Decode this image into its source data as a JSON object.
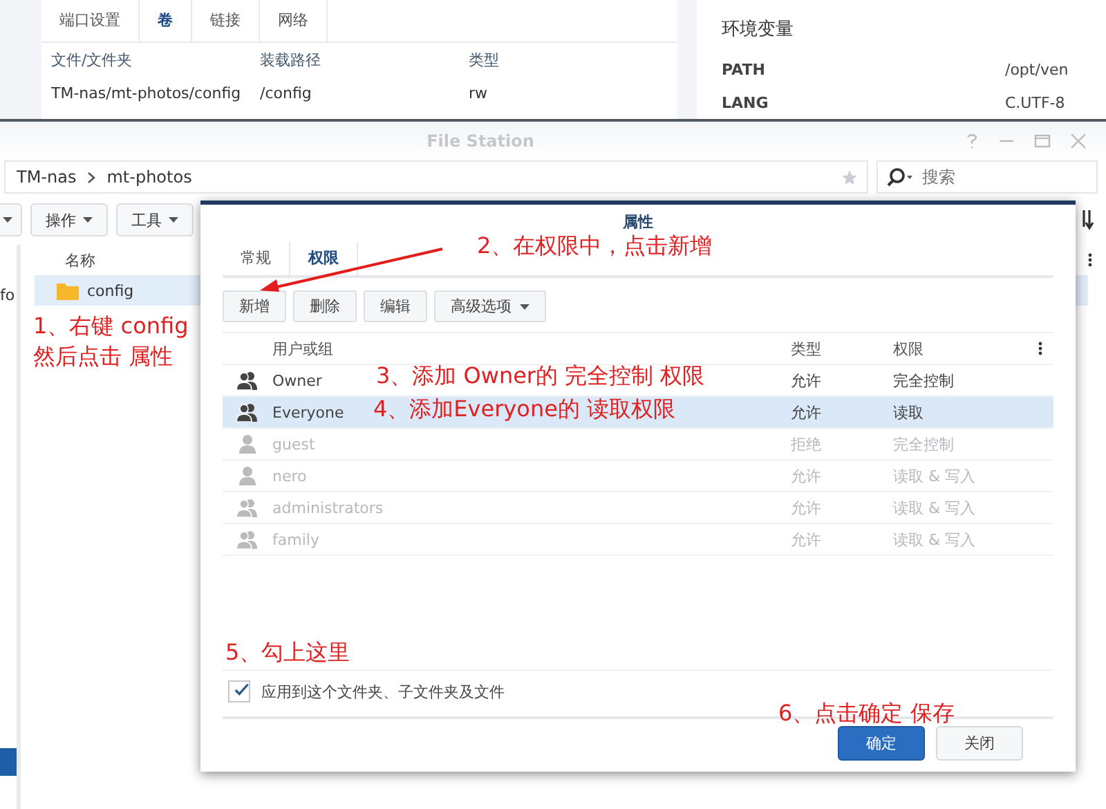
{
  "docker_panel": {
    "tabs": [
      {
        "label": "端口设置",
        "selected": false
      },
      {
        "label": "卷",
        "selected": true
      },
      {
        "label": "链接",
        "selected": false
      },
      {
        "label": "网络",
        "selected": false
      }
    ],
    "columns": [
      "文件/文件夹",
      "装载路径",
      "类型"
    ],
    "rows": [
      [
        "TM-nas/mt-photos/config",
        "/config",
        "rw"
      ]
    ]
  },
  "env_panel": {
    "title": "环境变量",
    "rows": [
      {
        "name": "PATH",
        "value": "/opt/ven"
      },
      {
        "name": "LANG",
        "value": "C.UTF-8"
      }
    ]
  },
  "file_station": {
    "title": "File Station",
    "breadcrumb": [
      "TM-nas",
      "mt-photos"
    ],
    "search": {
      "placeholder": "搜索"
    },
    "toolbar": [
      "操作",
      "工具"
    ],
    "sidebar_text": "fo",
    "list_header": "名称",
    "files": [
      {
        "name": "config",
        "selected": true
      }
    ]
  },
  "properties_dialog": {
    "title": "属性",
    "tabs": [
      {
        "label": "常规",
        "selected": false
      },
      {
        "label": "权限",
        "selected": true
      }
    ],
    "buttons": [
      {
        "label": "新增",
        "dropdown": false
      },
      {
        "label": "删除",
        "dropdown": false
      },
      {
        "label": "编辑",
        "dropdown": false
      },
      {
        "label": "高级选项",
        "dropdown": true
      }
    ],
    "columns": [
      "用户或组",
      "类型",
      "权限"
    ],
    "rows": [
      {
        "kind": "group",
        "name": "Owner",
        "type": "允许",
        "permission": "完全控制",
        "selected": false,
        "disabled": false
      },
      {
        "kind": "group",
        "name": "Everyone",
        "type": "允许",
        "permission": "读取",
        "selected": true,
        "disabled": false
      },
      {
        "kind": "user",
        "name": "guest",
        "type": "拒绝",
        "permission": "完全控制",
        "selected": false,
        "disabled": true
      },
      {
        "kind": "user",
        "name": "nero",
        "type": "允许",
        "permission": "读取 & 写入",
        "selected": false,
        "disabled": true
      },
      {
        "kind": "group",
        "name": "administrators",
        "type": "允许",
        "permission": "读取 & 写入",
        "selected": false,
        "disabled": true
      },
      {
        "kind": "group",
        "name": "family",
        "type": "允许",
        "permission": "读取 & 写入",
        "selected": false,
        "disabled": true
      }
    ],
    "apply_checkbox": {
      "label": "应用到这个文件夹、子文件夹及文件",
      "checked": true
    },
    "footer_buttons": [
      {
        "label": "确定",
        "kind": "primary"
      },
      {
        "label": "关闭",
        "kind": "secondary"
      }
    ]
  },
  "annotations": [
    "1、右键 config\n然后点击 属性",
    "2、在权限中，点击新增",
    "3、添加 Owner的 完全控制 权限",
    "4、添加Everyone的 读取权限",
    "5、勾上这里",
    "6、点击确定 保存"
  ]
}
